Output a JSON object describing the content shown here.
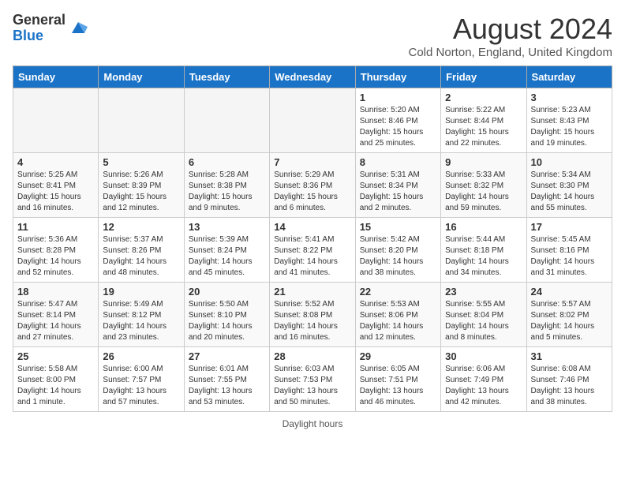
{
  "header": {
    "logo_general": "General",
    "logo_blue": "Blue",
    "month_year": "August 2024",
    "location": "Cold Norton, England, United Kingdom"
  },
  "footer": {
    "daylight_label": "Daylight hours"
  },
  "columns": [
    "Sunday",
    "Monday",
    "Tuesday",
    "Wednesday",
    "Thursday",
    "Friday",
    "Saturday"
  ],
  "weeks": [
    [
      {
        "day": "",
        "info": ""
      },
      {
        "day": "",
        "info": ""
      },
      {
        "day": "",
        "info": ""
      },
      {
        "day": "",
        "info": ""
      },
      {
        "day": "1",
        "info": "Sunrise: 5:20 AM\nSunset: 8:46 PM\nDaylight: 15 hours\nand 25 minutes."
      },
      {
        "day": "2",
        "info": "Sunrise: 5:22 AM\nSunset: 8:44 PM\nDaylight: 15 hours\nand 22 minutes."
      },
      {
        "day": "3",
        "info": "Sunrise: 5:23 AM\nSunset: 8:43 PM\nDaylight: 15 hours\nand 19 minutes."
      }
    ],
    [
      {
        "day": "4",
        "info": "Sunrise: 5:25 AM\nSunset: 8:41 PM\nDaylight: 15 hours\nand 16 minutes."
      },
      {
        "day": "5",
        "info": "Sunrise: 5:26 AM\nSunset: 8:39 PM\nDaylight: 15 hours\nand 12 minutes."
      },
      {
        "day": "6",
        "info": "Sunrise: 5:28 AM\nSunset: 8:38 PM\nDaylight: 15 hours\nand 9 minutes."
      },
      {
        "day": "7",
        "info": "Sunrise: 5:29 AM\nSunset: 8:36 PM\nDaylight: 15 hours\nand 6 minutes."
      },
      {
        "day": "8",
        "info": "Sunrise: 5:31 AM\nSunset: 8:34 PM\nDaylight: 15 hours\nand 2 minutes."
      },
      {
        "day": "9",
        "info": "Sunrise: 5:33 AM\nSunset: 8:32 PM\nDaylight: 14 hours\nand 59 minutes."
      },
      {
        "day": "10",
        "info": "Sunrise: 5:34 AM\nSunset: 8:30 PM\nDaylight: 14 hours\nand 55 minutes."
      }
    ],
    [
      {
        "day": "11",
        "info": "Sunrise: 5:36 AM\nSunset: 8:28 PM\nDaylight: 14 hours\nand 52 minutes."
      },
      {
        "day": "12",
        "info": "Sunrise: 5:37 AM\nSunset: 8:26 PM\nDaylight: 14 hours\nand 48 minutes."
      },
      {
        "day": "13",
        "info": "Sunrise: 5:39 AM\nSunset: 8:24 PM\nDaylight: 14 hours\nand 45 minutes."
      },
      {
        "day": "14",
        "info": "Sunrise: 5:41 AM\nSunset: 8:22 PM\nDaylight: 14 hours\nand 41 minutes."
      },
      {
        "day": "15",
        "info": "Sunrise: 5:42 AM\nSunset: 8:20 PM\nDaylight: 14 hours\nand 38 minutes."
      },
      {
        "day": "16",
        "info": "Sunrise: 5:44 AM\nSunset: 8:18 PM\nDaylight: 14 hours\nand 34 minutes."
      },
      {
        "day": "17",
        "info": "Sunrise: 5:45 AM\nSunset: 8:16 PM\nDaylight: 14 hours\nand 31 minutes."
      }
    ],
    [
      {
        "day": "18",
        "info": "Sunrise: 5:47 AM\nSunset: 8:14 PM\nDaylight: 14 hours\nand 27 minutes."
      },
      {
        "day": "19",
        "info": "Sunrise: 5:49 AM\nSunset: 8:12 PM\nDaylight: 14 hours\nand 23 minutes."
      },
      {
        "day": "20",
        "info": "Sunrise: 5:50 AM\nSunset: 8:10 PM\nDaylight: 14 hours\nand 20 minutes."
      },
      {
        "day": "21",
        "info": "Sunrise: 5:52 AM\nSunset: 8:08 PM\nDaylight: 14 hours\nand 16 minutes."
      },
      {
        "day": "22",
        "info": "Sunrise: 5:53 AM\nSunset: 8:06 PM\nDaylight: 14 hours\nand 12 minutes."
      },
      {
        "day": "23",
        "info": "Sunrise: 5:55 AM\nSunset: 8:04 PM\nDaylight: 14 hours\nand 8 minutes."
      },
      {
        "day": "24",
        "info": "Sunrise: 5:57 AM\nSunset: 8:02 PM\nDaylight: 14 hours\nand 5 minutes."
      }
    ],
    [
      {
        "day": "25",
        "info": "Sunrise: 5:58 AM\nSunset: 8:00 PM\nDaylight: 14 hours\nand 1 minute."
      },
      {
        "day": "26",
        "info": "Sunrise: 6:00 AM\nSunset: 7:57 PM\nDaylight: 13 hours\nand 57 minutes."
      },
      {
        "day": "27",
        "info": "Sunrise: 6:01 AM\nSunset: 7:55 PM\nDaylight: 13 hours\nand 53 minutes."
      },
      {
        "day": "28",
        "info": "Sunrise: 6:03 AM\nSunset: 7:53 PM\nDaylight: 13 hours\nand 50 minutes."
      },
      {
        "day": "29",
        "info": "Sunrise: 6:05 AM\nSunset: 7:51 PM\nDaylight: 13 hours\nand 46 minutes."
      },
      {
        "day": "30",
        "info": "Sunrise: 6:06 AM\nSunset: 7:49 PM\nDaylight: 13 hours\nand 42 minutes."
      },
      {
        "day": "31",
        "info": "Sunrise: 6:08 AM\nSunset: 7:46 PM\nDaylight: 13 hours\nand 38 minutes."
      }
    ]
  ]
}
